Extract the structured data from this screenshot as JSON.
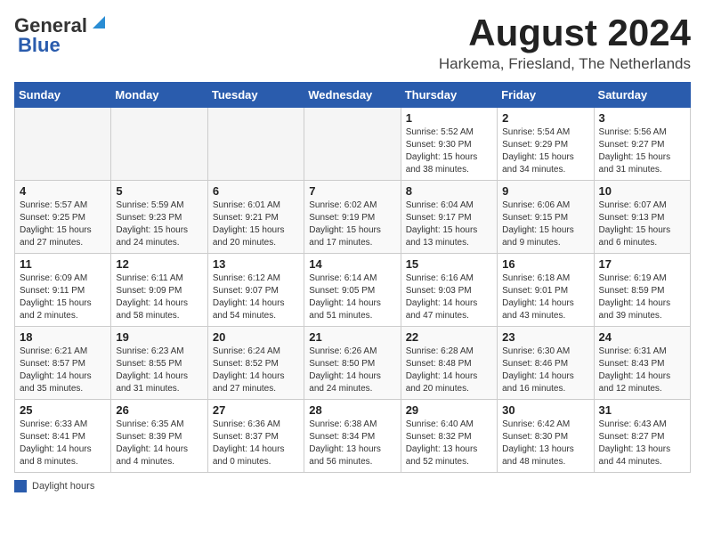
{
  "header": {
    "logo_general": "General",
    "logo_blue": "Blue",
    "month_title": "August 2024",
    "location": "Harkema, Friesland, The Netherlands"
  },
  "days_of_week": [
    "Sunday",
    "Monday",
    "Tuesday",
    "Wednesday",
    "Thursday",
    "Friday",
    "Saturday"
  ],
  "footer": {
    "legend_label": "Daylight hours"
  },
  "weeks": [
    [
      {
        "day": "",
        "empty": true
      },
      {
        "day": "",
        "empty": true
      },
      {
        "day": "",
        "empty": true
      },
      {
        "day": "",
        "empty": true
      },
      {
        "day": "1",
        "sunrise": "Sunrise: 5:52 AM",
        "sunset": "Sunset: 9:30 PM",
        "daylight": "Daylight: 15 hours and 38 minutes."
      },
      {
        "day": "2",
        "sunrise": "Sunrise: 5:54 AM",
        "sunset": "Sunset: 9:29 PM",
        "daylight": "Daylight: 15 hours and 34 minutes."
      },
      {
        "day": "3",
        "sunrise": "Sunrise: 5:56 AM",
        "sunset": "Sunset: 9:27 PM",
        "daylight": "Daylight: 15 hours and 31 minutes."
      }
    ],
    [
      {
        "day": "4",
        "sunrise": "Sunrise: 5:57 AM",
        "sunset": "Sunset: 9:25 PM",
        "daylight": "Daylight: 15 hours and 27 minutes."
      },
      {
        "day": "5",
        "sunrise": "Sunrise: 5:59 AM",
        "sunset": "Sunset: 9:23 PM",
        "daylight": "Daylight: 15 hours and 24 minutes."
      },
      {
        "day": "6",
        "sunrise": "Sunrise: 6:01 AM",
        "sunset": "Sunset: 9:21 PM",
        "daylight": "Daylight: 15 hours and 20 minutes."
      },
      {
        "day": "7",
        "sunrise": "Sunrise: 6:02 AM",
        "sunset": "Sunset: 9:19 PM",
        "daylight": "Daylight: 15 hours and 17 minutes."
      },
      {
        "day": "8",
        "sunrise": "Sunrise: 6:04 AM",
        "sunset": "Sunset: 9:17 PM",
        "daylight": "Daylight: 15 hours and 13 minutes."
      },
      {
        "day": "9",
        "sunrise": "Sunrise: 6:06 AM",
        "sunset": "Sunset: 9:15 PM",
        "daylight": "Daylight: 15 hours and 9 minutes."
      },
      {
        "day": "10",
        "sunrise": "Sunrise: 6:07 AM",
        "sunset": "Sunset: 9:13 PM",
        "daylight": "Daylight: 15 hours and 6 minutes."
      }
    ],
    [
      {
        "day": "11",
        "sunrise": "Sunrise: 6:09 AM",
        "sunset": "Sunset: 9:11 PM",
        "daylight": "Daylight: 15 hours and 2 minutes."
      },
      {
        "day": "12",
        "sunrise": "Sunrise: 6:11 AM",
        "sunset": "Sunset: 9:09 PM",
        "daylight": "Daylight: 14 hours and 58 minutes."
      },
      {
        "day": "13",
        "sunrise": "Sunrise: 6:12 AM",
        "sunset": "Sunset: 9:07 PM",
        "daylight": "Daylight: 14 hours and 54 minutes."
      },
      {
        "day": "14",
        "sunrise": "Sunrise: 6:14 AM",
        "sunset": "Sunset: 9:05 PM",
        "daylight": "Daylight: 14 hours and 51 minutes."
      },
      {
        "day": "15",
        "sunrise": "Sunrise: 6:16 AM",
        "sunset": "Sunset: 9:03 PM",
        "daylight": "Daylight: 14 hours and 47 minutes."
      },
      {
        "day": "16",
        "sunrise": "Sunrise: 6:18 AM",
        "sunset": "Sunset: 9:01 PM",
        "daylight": "Daylight: 14 hours and 43 minutes."
      },
      {
        "day": "17",
        "sunrise": "Sunrise: 6:19 AM",
        "sunset": "Sunset: 8:59 PM",
        "daylight": "Daylight: 14 hours and 39 minutes."
      }
    ],
    [
      {
        "day": "18",
        "sunrise": "Sunrise: 6:21 AM",
        "sunset": "Sunset: 8:57 PM",
        "daylight": "Daylight: 14 hours and 35 minutes."
      },
      {
        "day": "19",
        "sunrise": "Sunrise: 6:23 AM",
        "sunset": "Sunset: 8:55 PM",
        "daylight": "Daylight: 14 hours and 31 minutes."
      },
      {
        "day": "20",
        "sunrise": "Sunrise: 6:24 AM",
        "sunset": "Sunset: 8:52 PM",
        "daylight": "Daylight: 14 hours and 27 minutes."
      },
      {
        "day": "21",
        "sunrise": "Sunrise: 6:26 AM",
        "sunset": "Sunset: 8:50 PM",
        "daylight": "Daylight: 14 hours and 24 minutes."
      },
      {
        "day": "22",
        "sunrise": "Sunrise: 6:28 AM",
        "sunset": "Sunset: 8:48 PM",
        "daylight": "Daylight: 14 hours and 20 minutes."
      },
      {
        "day": "23",
        "sunrise": "Sunrise: 6:30 AM",
        "sunset": "Sunset: 8:46 PM",
        "daylight": "Daylight: 14 hours and 16 minutes."
      },
      {
        "day": "24",
        "sunrise": "Sunrise: 6:31 AM",
        "sunset": "Sunset: 8:43 PM",
        "daylight": "Daylight: 14 hours and 12 minutes."
      }
    ],
    [
      {
        "day": "25",
        "sunrise": "Sunrise: 6:33 AM",
        "sunset": "Sunset: 8:41 PM",
        "daylight": "Daylight: 14 hours and 8 minutes."
      },
      {
        "day": "26",
        "sunrise": "Sunrise: 6:35 AM",
        "sunset": "Sunset: 8:39 PM",
        "daylight": "Daylight: 14 hours and 4 minutes."
      },
      {
        "day": "27",
        "sunrise": "Sunrise: 6:36 AM",
        "sunset": "Sunset: 8:37 PM",
        "daylight": "Daylight: 14 hours and 0 minutes."
      },
      {
        "day": "28",
        "sunrise": "Sunrise: 6:38 AM",
        "sunset": "Sunset: 8:34 PM",
        "daylight": "Daylight: 13 hours and 56 minutes."
      },
      {
        "day": "29",
        "sunrise": "Sunrise: 6:40 AM",
        "sunset": "Sunset: 8:32 PM",
        "daylight": "Daylight: 13 hours and 52 minutes."
      },
      {
        "day": "30",
        "sunrise": "Sunrise: 6:42 AM",
        "sunset": "Sunset: 8:30 PM",
        "daylight": "Daylight: 13 hours and 48 minutes."
      },
      {
        "day": "31",
        "sunrise": "Sunrise: 6:43 AM",
        "sunset": "Sunset: 8:27 PM",
        "daylight": "Daylight: 13 hours and 44 minutes."
      }
    ]
  ]
}
